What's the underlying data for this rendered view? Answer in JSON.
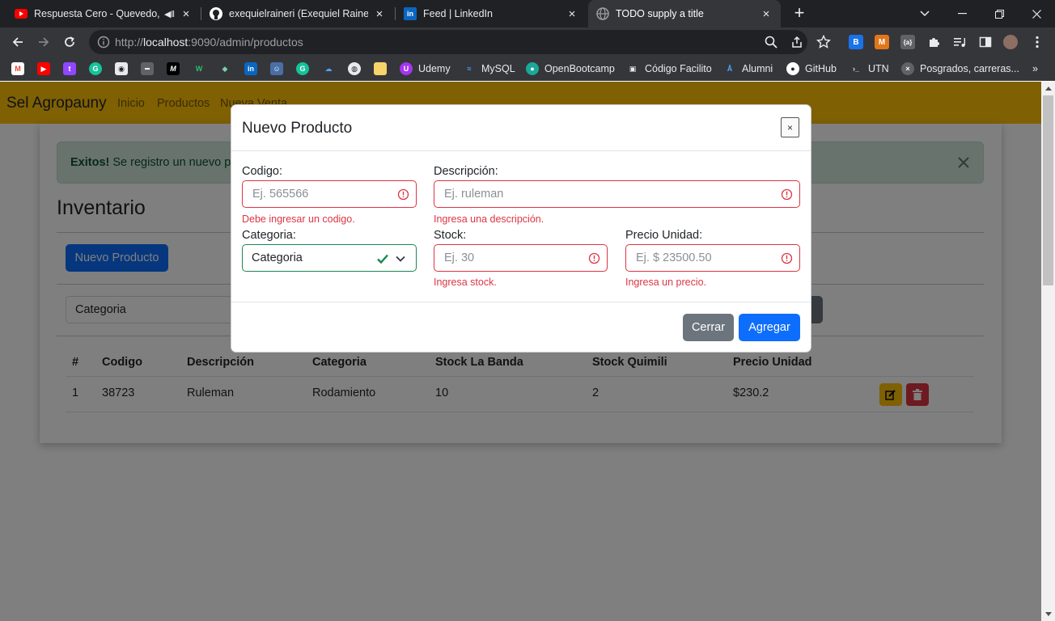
{
  "browser": {
    "tabs": [
      {
        "title": "Respuesta Cero - Quevedo, B",
        "favicon": "youtube-icon",
        "active": false
      },
      {
        "title": "exequielraineri (Exequiel Raineri)",
        "favicon": "github-icon",
        "active": false
      },
      {
        "title": "Feed | LinkedIn",
        "favicon": "linkedin-icon",
        "active": false
      },
      {
        "title": "TODO supply a title",
        "favicon": "globe-icon",
        "active": true
      }
    ],
    "url_scheme": "http://",
    "url_host": "localhost",
    "url_path": ":9090/admin/productos",
    "bookmarks": [
      {
        "label": "Udemy"
      },
      {
        "label": "MySQL"
      },
      {
        "label": "OpenBootcamp"
      },
      {
        "label": "Código Facilito"
      },
      {
        "label": "Alumni"
      },
      {
        "label": "GitHub"
      },
      {
        "label": "UTN"
      },
      {
        "label": "Posgrados, carreras..."
      }
    ],
    "bookmarks_more": "»"
  },
  "app": {
    "brand": "Sel Agropauny",
    "nav": [
      "Inicio",
      "Productos",
      "Nueva Venta"
    ],
    "alert_strong": "Exitos!",
    "alert_text": "Se registro un nuevo producto",
    "page_title": "Inventario",
    "new_product_button": "Nuevo Producto",
    "filter_value": "Categoria",
    "table": {
      "headers": [
        "#",
        "Codigo",
        "Descripción",
        "Categoria",
        "Stock La Banda",
        "Stock Quimili",
        "Precio Unidad"
      ],
      "rows": [
        [
          "1",
          "38723",
          "Ruleman",
          "Rodamiento",
          "10",
          "2",
          "$230.2"
        ]
      ]
    }
  },
  "modal": {
    "title": "Nuevo Producto",
    "close_symbol": "×",
    "fields": {
      "codigo": {
        "label": "Codigo:",
        "placeholder": "Ej. 565566",
        "error": "Debe ingresar un codigo."
      },
      "descripcion": {
        "label": "Descripción:",
        "placeholder": "Ej. ruleman",
        "error": "Ingresa una descripción."
      },
      "categoria": {
        "label": "Categoria:",
        "value": "Categoria"
      },
      "stock": {
        "label": "Stock:",
        "placeholder": "Ej. 30",
        "error": "Ingresa stock."
      },
      "precio": {
        "label": "Precio Unidad:",
        "placeholder": "Ej. $ 23500.50",
        "error": "Ingresa un precio."
      }
    },
    "cancel_button": "Cerrar",
    "submit_button": "Agregar"
  },
  "colors": {
    "navbar": "#ffc107",
    "primary": "#0d6efd",
    "secondary": "#6c757d",
    "danger": "#dc3545",
    "success": "#198754",
    "alert_bg": "#d1e7dd",
    "chrome_dark": "#202124",
    "chrome_toolbar": "#35363a"
  }
}
